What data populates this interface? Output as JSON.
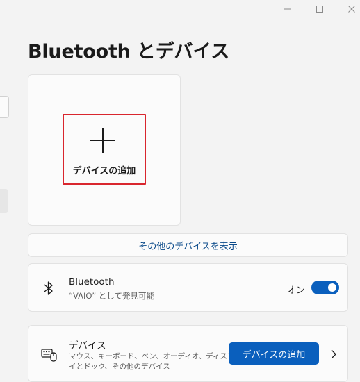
{
  "page": {
    "title": "Bluetooth とデバイス"
  },
  "add_device_card": {
    "label": "デバイスの追加",
    "icon": "plus-icon"
  },
  "show_more": {
    "label": "その他のデバイスを表示"
  },
  "bluetooth_row": {
    "icon": "bluetooth-icon",
    "title": "Bluetooth",
    "subtitle": "“VAIO” として発見可能",
    "toggle_label": "オン",
    "toggle_on": true
  },
  "devices_row": {
    "icon": "keyboard-mouse-icon",
    "title": "デバイス",
    "subtitle_line1": "マウス、キーボード、ペン、オーディオ、ディスプレ",
    "subtitle_line2": "イとドック、その他のデバイス",
    "button_label": "デバイスの追加",
    "chevron_icon": "chevron-right-icon"
  },
  "colors": {
    "accent": "#0a5fbd",
    "highlight": "#d9262e",
    "background": "#f3f3f3"
  }
}
